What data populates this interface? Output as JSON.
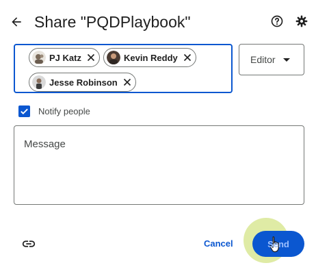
{
  "dialog": {
    "title": "Share \"PQDPlaybook\"",
    "icons": {
      "back": "arrow-left-icon",
      "help": "help-circle-icon",
      "settings": "gear-icon"
    }
  },
  "recipients": [
    {
      "name": "PJ Katz",
      "avatar": "avatar-pj-katz"
    },
    {
      "name": "Kevin Reddy",
      "avatar": "avatar-kevin-reddy"
    },
    {
      "name": "Jesse Robinson",
      "avatar": "avatar-jesse-robinson"
    }
  ],
  "role": {
    "selected": "Editor",
    "icon": "caret-down-icon"
  },
  "notify": {
    "label": "Notify people",
    "checked": true
  },
  "message": {
    "placeholder": "Message"
  },
  "footer": {
    "link_icon": "link-icon",
    "cancel_label": "Cancel",
    "send_label": "Send"
  },
  "colors": {
    "accent": "#0b57d0",
    "text": "#1f1f1f",
    "border": "#747775",
    "click_halo": "#d6e68c"
  }
}
